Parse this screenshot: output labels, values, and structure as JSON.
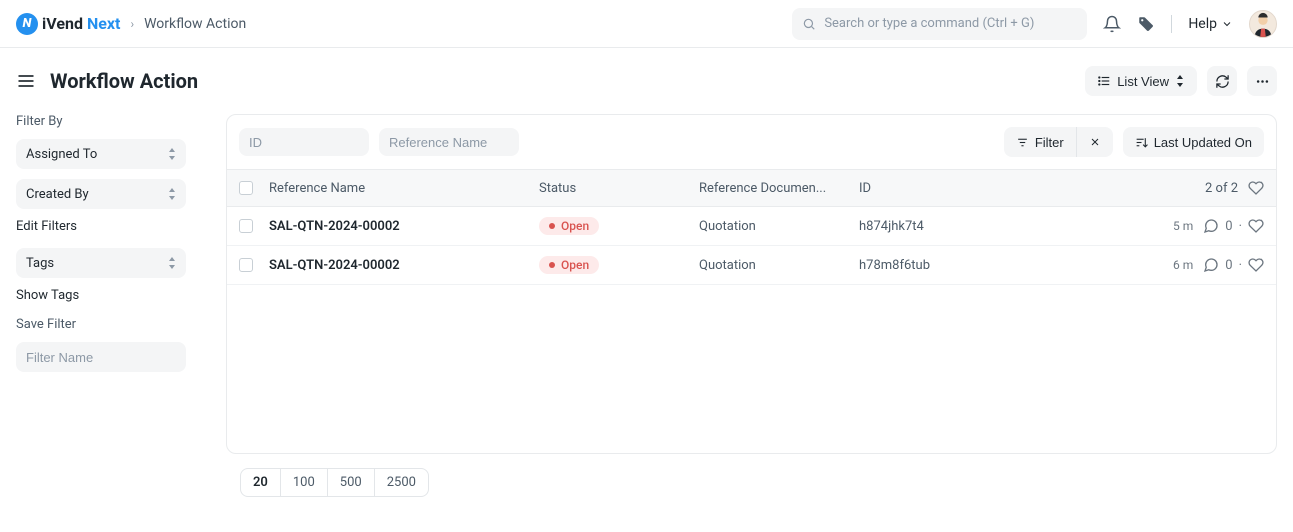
{
  "brand": {
    "part1": "iVend",
    "part2": "Next"
  },
  "breadcrumb": "Workflow Action",
  "search": {
    "placeholder": "Search or type a command (Ctrl + G)"
  },
  "nav": {
    "help": "Help"
  },
  "page": {
    "title": "Workflow Action"
  },
  "head_actions": {
    "view": "List View"
  },
  "sidebar": {
    "filter_by_label": "Filter By",
    "assigned_to": "Assigned To",
    "created_by": "Created By",
    "edit_filters": "Edit Filters",
    "tags": "Tags",
    "show_tags": "Show Tags",
    "save_filter": "Save Filter",
    "filter_name_placeholder": "Filter Name"
  },
  "toolbar": {
    "id_placeholder": "ID",
    "ref_placeholder": "Reference Name",
    "filter": "Filter",
    "sort": "Last Updated On"
  },
  "columns": {
    "reference_name": "Reference Name",
    "status": "Status",
    "reference_document": "Reference Documen...",
    "id": "ID",
    "count": "2 of 2"
  },
  "rows": [
    {
      "ref": "SAL-QTN-2024-00002",
      "status": "Open",
      "doc": "Quotation",
      "id": "h874jhk7t4",
      "time": "5 m",
      "comments": "0"
    },
    {
      "ref": "SAL-QTN-2024-00002",
      "status": "Open",
      "doc": "Quotation",
      "id": "h78m8f6tub",
      "time": "6 m",
      "comments": "0"
    }
  ],
  "paginator": {
    "p20": "20",
    "p100": "100",
    "p500": "500",
    "p2500": "2500"
  }
}
